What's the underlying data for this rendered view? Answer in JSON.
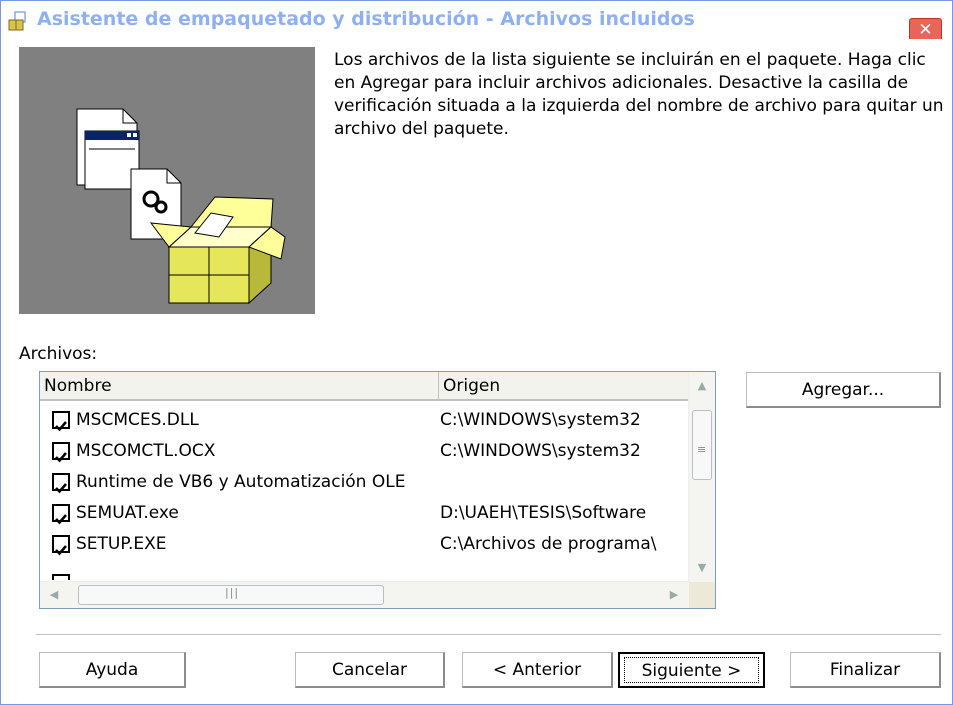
{
  "window": {
    "title": "Asistente de empaquetado y distribución - Archivos incluidos",
    "close_glyph": "✕"
  },
  "description": "Los archivos de la lista siguiente se incluirán en el paquete. Haga clic en Agregar para incluir archivos adicionales. Desactive la casilla de verificación situada a la izquierda del nombre de archivo para quitar un archivo del paquete.",
  "files": {
    "label": "Archivos:",
    "columns": [
      "Nombre",
      "Origen"
    ],
    "rows": [
      {
        "checked": true,
        "name": "MSCMCES.DLL",
        "origin": "C:\\WINDOWS\\system32"
      },
      {
        "checked": true,
        "name": "MSCOMCTL.OCX",
        "origin": "C:\\WINDOWS\\system32"
      },
      {
        "checked": true,
        "name": "Runtime de VB6 y Automatización OLE",
        "origin": ""
      },
      {
        "checked": true,
        "name": "SEMUAT.exe",
        "origin": "D:\\UAEH\\TESIS\\Software"
      },
      {
        "checked": true,
        "name": "SETUP.EXE",
        "origin": "C:\\Archivos de programa\\"
      }
    ]
  },
  "buttons": {
    "agregar": "Agregar...",
    "ayuda": "Ayuda",
    "cancelar": "Cancelar",
    "anterior": "< Anterior",
    "siguiente": "Siguiente >",
    "finalizar": "Finalizar"
  },
  "icons": {
    "title": "package-setup-icon",
    "illustration": "package-box-illustration",
    "check": "checkmark-icon"
  }
}
